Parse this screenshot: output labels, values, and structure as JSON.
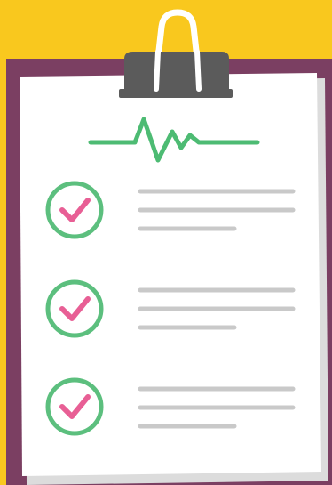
{
  "colors": {
    "background": "#F9C81E",
    "board": "#7B3F62",
    "paper": "#FFFFFF",
    "paper_shadow": "#DCDCDC",
    "clip": "#5B5B5B",
    "clip_ring": "#FFFFFF",
    "check_circle": "#5CBF7E",
    "check_mark": "#E85F95",
    "text_line": "#C9C9C9",
    "heartbeat": "#4DBB73"
  },
  "icons": {
    "heartbeat": "heartbeat-pulse-icon",
    "clip": "binder-clip-icon",
    "check": "checkmark-circle-icon"
  },
  "checklist": {
    "items": [
      {
        "checked": true
      },
      {
        "checked": true
      },
      {
        "checked": true
      }
    ]
  }
}
